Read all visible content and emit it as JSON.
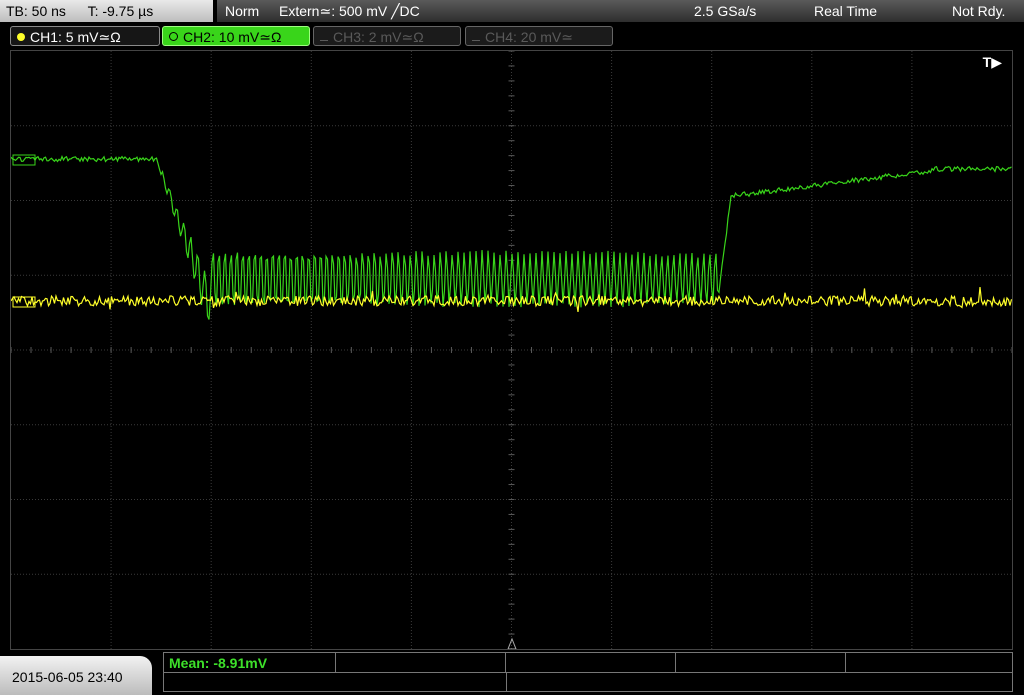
{
  "header": {
    "timebase": "TB: 50 ns",
    "trigger_time": "T: -9.75 µs",
    "trigger_mode": "Norm",
    "trigger_source": "Extern≃: 500 mV ╱DC",
    "sample_rate": "2.5 GSa/s",
    "acq_mode": "Real Time",
    "status": "Not Rdy."
  },
  "channels": [
    {
      "label": "CH1: 5 mV≃Ω",
      "color": "#ffff2a",
      "active": true
    },
    {
      "label": "CH2: 10 mV≃Ω",
      "color": "#39d51a",
      "active": true
    },
    {
      "label": "CH3: 2 mV≃Ω",
      "color": "#5a5a5a",
      "active": false
    },
    {
      "label": "CH4: 20 mV≃",
      "color": "#5a5a5a",
      "active": false
    }
  ],
  "screen": {
    "trigger_marker": "T▶",
    "grid_color": "#3a3a3a",
    "ch1_marker": "□",
    "ch2_marker": "□"
  },
  "footer": {
    "datetime": "2015-06-05 23:40",
    "measurement": "Mean: -8.91mV"
  }
}
